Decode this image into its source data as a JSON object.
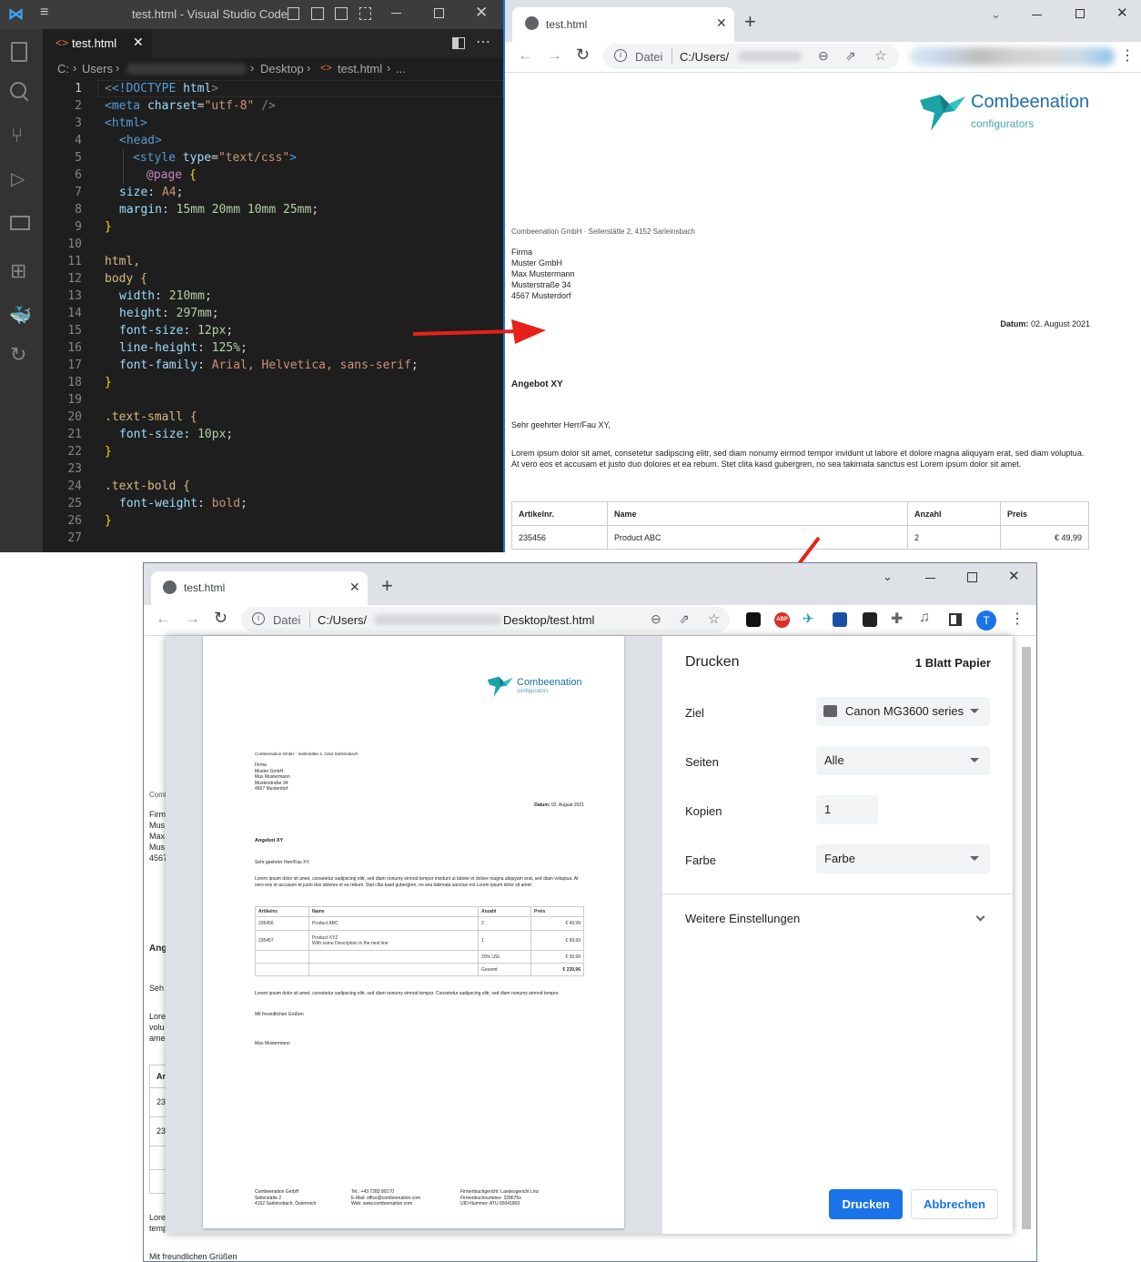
{
  "vscode": {
    "title": "test.html - Visual Studio Code",
    "tab_label": "test.html",
    "breadcrumb": {
      "drive": "C:",
      "users": "Users",
      "desktop": "Desktop",
      "file": "test.html",
      "more": "..."
    },
    "lines": [
      "1",
      "2",
      "3",
      "4",
      "5",
      "6",
      "7",
      "8",
      "9",
      "10",
      "11",
      "12",
      "13",
      "14",
      "15",
      "16",
      "17",
      "18",
      "19",
      "20",
      "21",
      "22",
      "23",
      "24",
      "25",
      "26",
      "27"
    ],
    "code": {
      "l1a": "<!DOCTYPE",
      "l1b": "html",
      "l1c": ">",
      "l2a": "<meta",
      "l2b": "charset",
      "l2c": "=",
      "l2d": "\"utf-8\"",
      "l2e": " />",
      "l3": "<html>",
      "l4": "<head>",
      "l5a": "<style",
      "l5b": "type",
      "l5c": "=",
      "l5d": "\"text/css\"",
      "l5e": ">",
      "l6a": "@page",
      "l6b": " {",
      "l7a": "size",
      "l7b": ": ",
      "l7c": "A4",
      "l7d": ";",
      "l8a": "margin",
      "l8b": ": ",
      "l8c": "15mm 20mm 10mm 25mm",
      "l8d": ";",
      "l9": "}",
      "l11": "html,",
      "l12": "body {",
      "l13a": "width",
      "l13b": ": ",
      "l13c": "210mm",
      "l13d": ";",
      "l14a": "height",
      "l14b": ": ",
      "l14c": "297mm",
      "l14d": ";",
      "l15a": "font-size",
      "l15b": ": ",
      "l15c": "12px",
      "l15d": ";",
      "l16a": "line-height",
      "l16b": ": ",
      "l16c": "125%",
      "l16d": ";",
      "l17a": "font-family",
      "l17b": ": ",
      "l17c": "Arial, Helvetica, sans-serif",
      "l17d": ";",
      "l18": "}",
      "l20": ".text-small {",
      "l21a": "font-size",
      "l21b": ": ",
      "l21c": "10px",
      "l21d": ";",
      "l22": "}",
      "l24": ".text-bold {",
      "l25a": "font-weight",
      "l25b": ": ",
      "l25c": "bold",
      "l25d": ";",
      "l26": "}"
    }
  },
  "browser1": {
    "tab_title": "test.html",
    "omnibox_scheme": "Datei",
    "omnibox_path": "C:/Users/"
  },
  "browser2": {
    "tab_title": "test.html",
    "omnibox_scheme": "Datei",
    "omnibox_path": "C:/Users/",
    "omnibox_path_tail": "Desktop/test.html",
    "avatar": "T"
  },
  "letter": {
    "logo_name": "Combeenation",
    "logo_sub": "configurators",
    "sender_line": "Combeenation GmbH · Seilerstätte 2, 4152 Sarleinsbach",
    "address": [
      "Firma",
      "Muster GmbH",
      "Max Mustermann",
      "Musterstraße 34",
      "4567 Musterdorf"
    ],
    "date_label": "Datum:",
    "date_value": "02. August 2021",
    "subject": "Angebot XY",
    "salutation": "Sehr geehrter Herr/Fau XY,",
    "body": "Lorem ipsum dolor sit amet, consetetur sadipscing elitr, sed diam nonumy eirmod tempor invidunt ut labore et dolore magna aliquyam erat, sed diam voluptua. At vero eos et accusam et justo duo dolores et ea rebum. Stet clita kasd gubergren, no sea takimata sanctus est Lorem ipsum dolor sit amet.",
    "table_headers": [
      "Artikelnr.",
      "Name",
      "Anzahl",
      "Preis"
    ],
    "rows": [
      {
        "nr": "235456",
        "name": "Product ABC",
        "desc": "",
        "qty": "2",
        "price": "€ 49,99"
      },
      {
        "nr": "235457",
        "name": "Product XYZ",
        "desc": "With some Description in the next line",
        "qty": "1",
        "price": "€ 99,99"
      }
    ],
    "tax_label": "20% USt.",
    "tax_value": "€ 39,99",
    "total_label": "Gesamt",
    "total_value": "€ 239,96",
    "closing_body": "Lorem ipsum dolor sit amet, consetetur sadipscing elitr, sed diam nonumy eirmod tempor. Consetetur sadipscing elitr, sed diam nonumy eirmod tempor.",
    "greeting": "Mit freundlichen Grüßen",
    "signature": "Max Mustermann",
    "footer": {
      "col1": [
        "Combeenation GmbH",
        "Seilerstätte 2",
        "4152 Sarleinsbach, Österreich"
      ],
      "col2": [
        "Tel.: +43 7283 80170",
        "E-Mail: office@combeenation.com",
        "Web: www.combeenation.com"
      ],
      "col3": [
        "Firmenbuchgericht: Landesgericht Linz",
        "Firmenbuchnummer: 328675s",
        "UID-Nummer: ATU 65041803"
      ]
    }
  },
  "background_page": {
    "snippets": [
      "Comb",
      "Firm",
      "Mus",
      "Max",
      "Mus",
      "4567",
      "Ang",
      "Seh",
      "Lore",
      "volu",
      "ame",
      "Ar",
      "23",
      "23",
      "Lore",
      "temp",
      "Mit freundlichen Grüßen"
    ]
  },
  "print": {
    "title": "Drucken",
    "sheets": "1 Blatt Papier",
    "destination_label": "Ziel",
    "destination_value": "Canon MG3600 series",
    "pages_label": "Seiten",
    "pages_value": "Alle",
    "copies_label": "Kopien",
    "copies_value": "1",
    "color_label": "Farbe",
    "color_value": "Farbe",
    "more_settings": "Weitere Einstellungen",
    "print_button": "Drucken",
    "cancel_button": "Abbrechen"
  },
  "colors": {
    "accent": "#1a73e8",
    "arrow": "#e8201a",
    "logo": "#1aa3a8",
    "vscode_bg": "#1e1e1e"
  }
}
